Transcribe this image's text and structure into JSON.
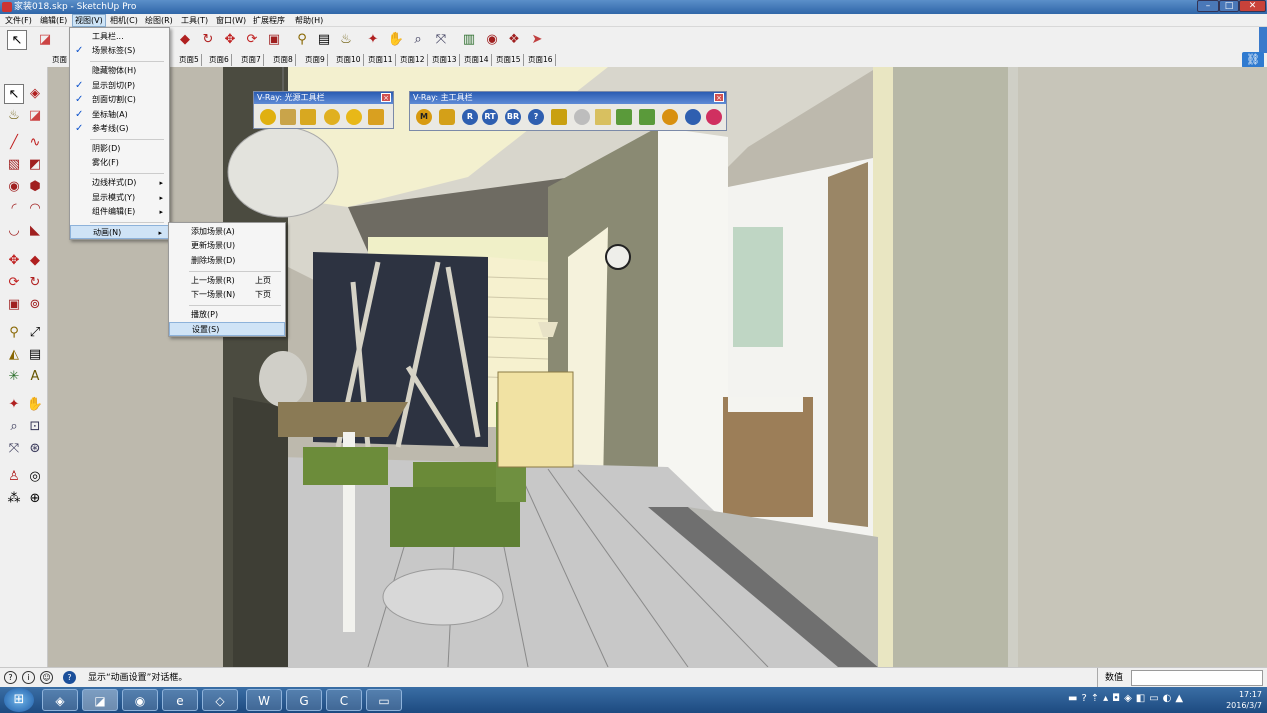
{
  "window": {
    "title": "家装018.skp - SketchUp Pro",
    "minimize": "–",
    "maximize": "□",
    "close": "✕"
  },
  "menubar": [
    "文件(F)",
    "编辑(E)",
    "视图(V)",
    "相机(C)",
    "绘图(R)",
    "工具(T)",
    "窗口(W)",
    "扩展程序",
    "帮助(H)"
  ],
  "scene_tabs": [
    "页面",
    "页面5",
    "页面6",
    "页面7",
    "页面8",
    "页面9",
    "页面10",
    "页面11",
    "页面12",
    "页面13",
    "页面14",
    "页面15",
    "页面16"
  ],
  "view_menu": {
    "items": [
      {
        "label": "工具栏...",
        "checked": false,
        "sub": false
      },
      {
        "label": "场景标签(S)",
        "checked": true,
        "sub": false
      },
      {
        "label": "隐藏物体(H)",
        "checked": false,
        "sub": false
      },
      {
        "label": "显示剖切(P)",
        "checked": true,
        "sub": false
      },
      {
        "label": "剖面切割(C)",
        "checked": true,
        "sub": false
      },
      {
        "label": "坐标轴(A)",
        "checked": true,
        "sub": false
      },
      {
        "label": "参考线(G)",
        "checked": true,
        "sub": false
      },
      {
        "label": "阴影(D)",
        "checked": false,
        "sub": false
      },
      {
        "label": "雾化(F)",
        "checked": false,
        "sub": false
      },
      {
        "label": "边线样式(D)",
        "checked": false,
        "sub": true
      },
      {
        "label": "显示模式(Y)",
        "checked": false,
        "sub": true
      },
      {
        "label": "组件编辑(E)",
        "checked": false,
        "sub": true
      },
      {
        "label": "动画(N)",
        "checked": false,
        "sub": true
      }
    ]
  },
  "animation_submenu": {
    "items": [
      {
        "label": "添加场景(A)",
        "shortcut": ""
      },
      {
        "label": "更新场景(U)",
        "shortcut": ""
      },
      {
        "label": "删除场景(D)",
        "shortcut": ""
      },
      {
        "label": "上一场景(R)",
        "shortcut": "上页"
      },
      {
        "label": "下一场景(N)",
        "shortcut": "下页"
      },
      {
        "label": "播放(P)",
        "shortcut": ""
      },
      {
        "label": "设置(S)",
        "shortcut": ""
      }
    ]
  },
  "vray_light_toolbar": {
    "title": "V-Ray: 光源工具栏"
  },
  "vray_main_toolbar": {
    "title": "V-Ray: 主工具栏",
    "buttons": [
      "M",
      "",
      "R",
      "RT",
      "BR",
      "?",
      "",
      "",
      "",
      "",
      "",
      "",
      "",
      ""
    ]
  },
  "status": {
    "message": "显示“动画设置”对话框。",
    "measure_label": "数值",
    "measure_value": ""
  },
  "tray": {
    "time": "17:17",
    "date": "2016/3/7"
  }
}
